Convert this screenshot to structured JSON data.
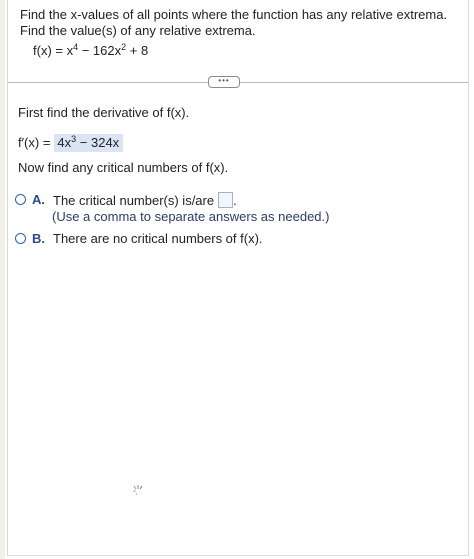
{
  "question": {
    "prompt": "Find the x-values of all points where the function has any relative extrema. Find the value(s) of any relative extrema.",
    "function_prefix": "f(x) = x",
    "function_exp1": "4",
    "function_mid": " − 162x",
    "function_exp2": "2",
    "function_suffix": " + 8"
  },
  "more_button": {
    "label": "•••"
  },
  "steps": {
    "step1": "First find the derivative of f(x).",
    "derivative_label": "f′(x) =",
    "derivative_prefix": "4x",
    "derivative_exp": "3",
    "derivative_suffix": " − 324x",
    "step2": "Now find any critical numbers of f(x)."
  },
  "options": {
    "a_letter": "A.",
    "a_text": "The critical number(s) is/are",
    "a_period": ".",
    "a_hint": "(Use a comma to separate answers as needed.)",
    "b_letter": "B.",
    "b_text": "There are no critical numbers of f(x)."
  },
  "colors": {
    "accent": "#2a63b5",
    "highlight": "#dbe4f5"
  }
}
